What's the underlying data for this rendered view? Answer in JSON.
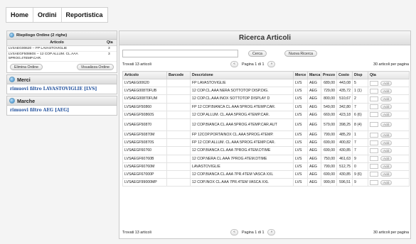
{
  "nav": [
    "Home",
    "Ordini",
    "Reportistica"
  ],
  "riepilogo": {
    "title": "Riepilogo Ordine (2 righe)",
    "col_articolo": "Articolo",
    "col_qta": "Qta",
    "rows": [
      {
        "text": "LVSAEG00620 -- FP LAVASTOVIGLIE",
        "qta": "3"
      },
      {
        "text": "LVSAEGF50860S -- 12 COP.ALLUM. CL.AAA 5PROG.4TEMP.CAR.",
        "qta": "3"
      }
    ],
    "btn_elimina": "Elimina Ordine",
    "btn_visualizza": "Visualizza Ordine"
  },
  "merci": {
    "title": "Merci",
    "filter": "rimuovi filtro LAVASTOVIGLIE [LVS]"
  },
  "marche": {
    "title": "Marche",
    "filter": "rimuovi filtro AEG [AEG]"
  },
  "main": {
    "title": "Ricerca Articoli",
    "search_value": "",
    "btn_cerca": "Cerca",
    "btn_nuova": "Nuova Ricerca",
    "found": "Trovati 13 articoli",
    "page_label": "Pagina 1 di 1",
    "per_page": "30 articoli per pagina",
    "add_label": "Add",
    "columns": [
      "Articolo",
      "Barcode",
      "Descrizione",
      "Merce",
      "Marca",
      "Prezzo",
      "Costo",
      "Disp",
      "Qta"
    ]
  },
  "rows": [
    {
      "articolo": "LVSAEG00620",
      "barcode": "",
      "descr": "FP LAVASTOVIGLIE",
      "merce": "LVS",
      "marca": "AEG",
      "prezzo": "689,00",
      "costo": "443,08",
      "disp": "5"
    },
    {
      "articolo": "LVSAEG00870FUB",
      "barcode": "",
      "descr": "12 COP.CL.AAA NERA SOTTOTOP DISP.DIG.",
      "merce": "LVS",
      "marca": "AEG",
      "prezzo": "729,00",
      "costo": "435,72",
      "disp": "1 (1)"
    },
    {
      "articolo": "LVSAEG00870FUM",
      "barcode": "",
      "descr": "12 COP.CL.AAA INOX SOTTOTOP DISPLAY D",
      "merce": "LVS",
      "marca": "AEG",
      "prezzo": "800,00",
      "costo": "510,67",
      "disp": "2"
    },
    {
      "articolo": "LVSAEGF50860",
      "barcode": "",
      "descr": "FP 12 COP.BIANCA CL.AAA 5PROG.4TEMP.CAR.",
      "merce": "LVS",
      "marca": "AEG",
      "prezzo": "549,00",
      "costo": "342,80",
      "disp": "7"
    },
    {
      "articolo": "LVSAEGF50860S",
      "barcode": "",
      "descr": "12 COP.ALLUM. CL.AAA 5PROG.4TEMP.CAR.",
      "merce": "LVS",
      "marca": "AEG",
      "prezzo": "669,00",
      "costo": "423,18",
      "disp": "6 (6)"
    },
    {
      "articolo": "LVSAEGF50870",
      "barcode": "",
      "descr": "12 COP.BIANCA CL.AAA 5PROG.4TEMP.CAR.AUT",
      "merce": "LVS",
      "marca": "AEG",
      "prezzo": "579,00",
      "costo": "398,25",
      "disp": "8 (4)",
      "tall": true
    },
    {
      "articolo": "LVSAEGF50870M",
      "barcode": "",
      "descr": "FP 12COP.PORTAINOX CL.AAA 5PROG.4TEMP.",
      "merce": "LVS",
      "marca": "AEG",
      "prezzo": "799,00",
      "costo": "485,29",
      "disp": "1"
    },
    {
      "articolo": "LVSAEGF50870S",
      "barcode": "",
      "descr": "FP 12 COP.ALLUM. CL.AAA 5PROG.4TEMP.CAR.",
      "merce": "LVS",
      "marca": "AEG",
      "prezzo": "699,00",
      "costo": "400,82",
      "disp": "7"
    },
    {
      "articolo": "LVSAEGF60760",
      "barcode": "",
      "descr": "12 COP.BIANCA CL.AAA 7PROG.4TEM.DTIME",
      "merce": "LVS",
      "marca": "AEG",
      "prezzo": "699,00",
      "costo": "430,85",
      "disp": "7"
    },
    {
      "articolo": "LVSAEGF60760B",
      "barcode": "",
      "descr": "12 COP.NERA CL.AAA 7PROG.4TEM.DTIME",
      "merce": "LVS",
      "marca": "AEG",
      "prezzo": "750,00",
      "costo": "461,63",
      "disp": "9"
    },
    {
      "articolo": "LVSAEGF60760M",
      "barcode": "",
      "descr": "LAVASTOVIGLIE",
      "merce": "LVS",
      "marca": "AEG",
      "prezzo": "799,00",
      "costo": "512,75",
      "disp": "0"
    },
    {
      "articolo": "LVSAEGF67000P",
      "barcode": "",
      "descr": "12 COP.BIANCA CL.AAA 7PR.4TEM VASCA XXL",
      "merce": "LVS",
      "marca": "AEG",
      "prezzo": "699,00",
      "costo": "430,85",
      "disp": "9 (6)"
    },
    {
      "articolo": "LVSAEGF99000MP",
      "barcode": "",
      "descr": "12 COP.INOX CL.AAA 7PR.4TEM VASCA XXL",
      "merce": "LVS",
      "marca": "AEG",
      "prezzo": "999,00",
      "costo": "596,51",
      "disp": "9"
    }
  ],
  "colors": {
    "accent": "#2f86c7",
    "filter_link": "#1f4f9c"
  }
}
